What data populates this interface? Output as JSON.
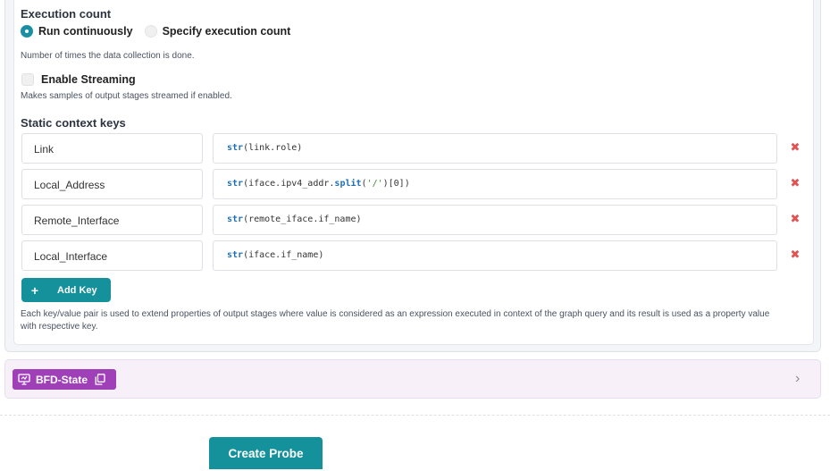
{
  "execution": {
    "title": "Execution count",
    "options": [
      {
        "label": "Run continuously",
        "selected": true
      },
      {
        "label": "Specify execution count",
        "selected": false
      }
    ],
    "help": "Number of times the data collection is done."
  },
  "streaming": {
    "label": "Enable Streaming",
    "checked": false,
    "help": "Makes samples of output stages streamed if enabled."
  },
  "context_keys": {
    "title": "Static context keys",
    "rows": [
      {
        "key": "Link",
        "value_kw": "str",
        "value_rest": "(link.role)"
      },
      {
        "key": "Local_Address",
        "value_kw": "str",
        "value_mid": "(iface.ipv4_addr.",
        "value_kw2": "split",
        "value_paren": "(",
        "value_str": "'/'",
        "value_end": ")[0])"
      },
      {
        "key": "Remote_Interface",
        "value_kw": "str",
        "value_rest": "(remote_iface.if_name)"
      },
      {
        "key": "Local_Interface",
        "value_kw": "str",
        "value_rest": "(iface.if_name)"
      }
    ],
    "delete_glyph": "✖",
    "add_key_label": "Add Key",
    "add_key_glyph": "+",
    "help_line1": "Each key/value pair is used to extend properties of output stages where value is considered as an expression executed in context of the graph query and its result is used as a property value",
    "help_line2": "with respective key."
  },
  "stage": {
    "name": "BFD-State",
    "icon": "stage-icon",
    "copy_icon": "copy-icon",
    "chevron_glyph": "›",
    "color": "#a040b8"
  },
  "actions": {
    "create_label": "Create Probe",
    "accent": "#14919b"
  }
}
